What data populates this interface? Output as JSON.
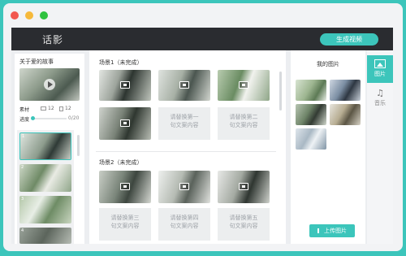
{
  "window": {
    "traffic_colors": [
      "#f2574f",
      "#f6b93b",
      "#2fc23f"
    ]
  },
  "appbar": {
    "title": "话影",
    "generate_button": "生成视频"
  },
  "left": {
    "story_title": "关于爱的故事",
    "material_label": "素材",
    "material_images": "12",
    "material_texts": "12",
    "progress_label": "进度",
    "progress_text": "0/20",
    "progress_fraction": 0,
    "scenes": [
      "1",
      "2",
      "3",
      "4"
    ]
  },
  "scene1": {
    "title": "场景1（未完成）",
    "placeholders": [
      "请替换第一句文案内容",
      "请替换第二句文案内容"
    ]
  },
  "scene2": {
    "title": "场景2（未完成）",
    "placeholders": [
      "请替换第三句文案内容",
      "请替换第四句文案内容",
      "请替换第五句文案内容"
    ]
  },
  "my_pictures": {
    "title": "我的图片",
    "upload_button": "上传图片"
  },
  "side_tabs": [
    {
      "label": "图片",
      "icon": "image-icon",
      "active": true
    },
    {
      "label": "音乐",
      "icon": "music-icon",
      "active": false
    }
  ],
  "colors": {
    "accent": "#3cc5bb",
    "appbar": "#2a2c30"
  }
}
